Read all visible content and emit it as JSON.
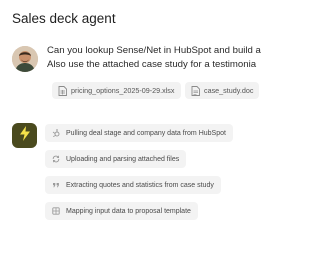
{
  "header": {
    "title": "Sales deck agent"
  },
  "user_message": {
    "line1": "Can you lookup Sense/Net in HubSpot and build a",
    "line2": "Also use the attached case study for a testimonia",
    "attachments": [
      {
        "name": "pricing_options_2025-09-29.xlsx",
        "icon": "spreadsheet-icon"
      },
      {
        "name": "case_study.doc",
        "icon": "document-icon"
      }
    ]
  },
  "agent": {
    "badge_icon": "lightning-icon",
    "badge_color": "#4a4a1e",
    "accent_color": "#f5e24a",
    "steps": [
      {
        "label": "Pulling deal stage and company data from HubSpot",
        "icon": "hubspot-icon"
      },
      {
        "label": "Uploading and parsing attached files",
        "icon": "refresh-icon"
      },
      {
        "label": "Extracting quotes and statistics from case study",
        "icon": "quote-icon"
      },
      {
        "label": "Mapping input data to proposal template",
        "icon": "grid-icon"
      }
    ]
  }
}
